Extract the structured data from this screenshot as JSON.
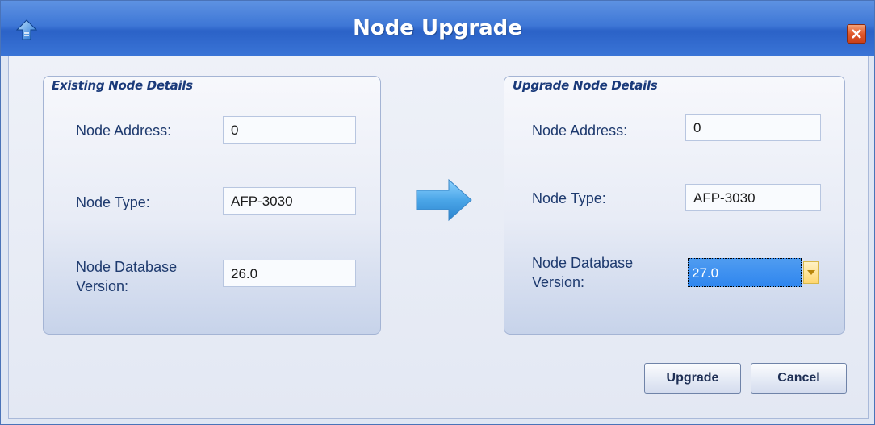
{
  "window": {
    "title": "Node Upgrade",
    "icon": "upgrade-arrow-icon",
    "close_icon": "close-icon"
  },
  "existing": {
    "group_title": "Existing Node Details",
    "node_address_label": "Node Address:",
    "node_address_value": "0",
    "node_type_label": "Node Type:",
    "node_type_value": "AFP-3030",
    "db_version_label_line1": "Node Database",
    "db_version_label_line2": "Version:",
    "db_version_value": "26.0"
  },
  "upgrade": {
    "group_title": "Upgrade Node Details",
    "node_address_label": "Node Address:",
    "node_address_value": "0",
    "node_type_label": "Node Type:",
    "node_type_value": "AFP-3030",
    "db_version_label_line1": "Node Database",
    "db_version_label_line2": "Version:",
    "db_version_selected": "27.0"
  },
  "center_icon": "arrow-right-icon",
  "buttons": {
    "upgrade_label": "Upgrade",
    "cancel_label": "Cancel"
  },
  "colors": {
    "titlebar": "#3e77d6",
    "selection": "#2f86ef",
    "label_text": "#1e3a6e"
  }
}
